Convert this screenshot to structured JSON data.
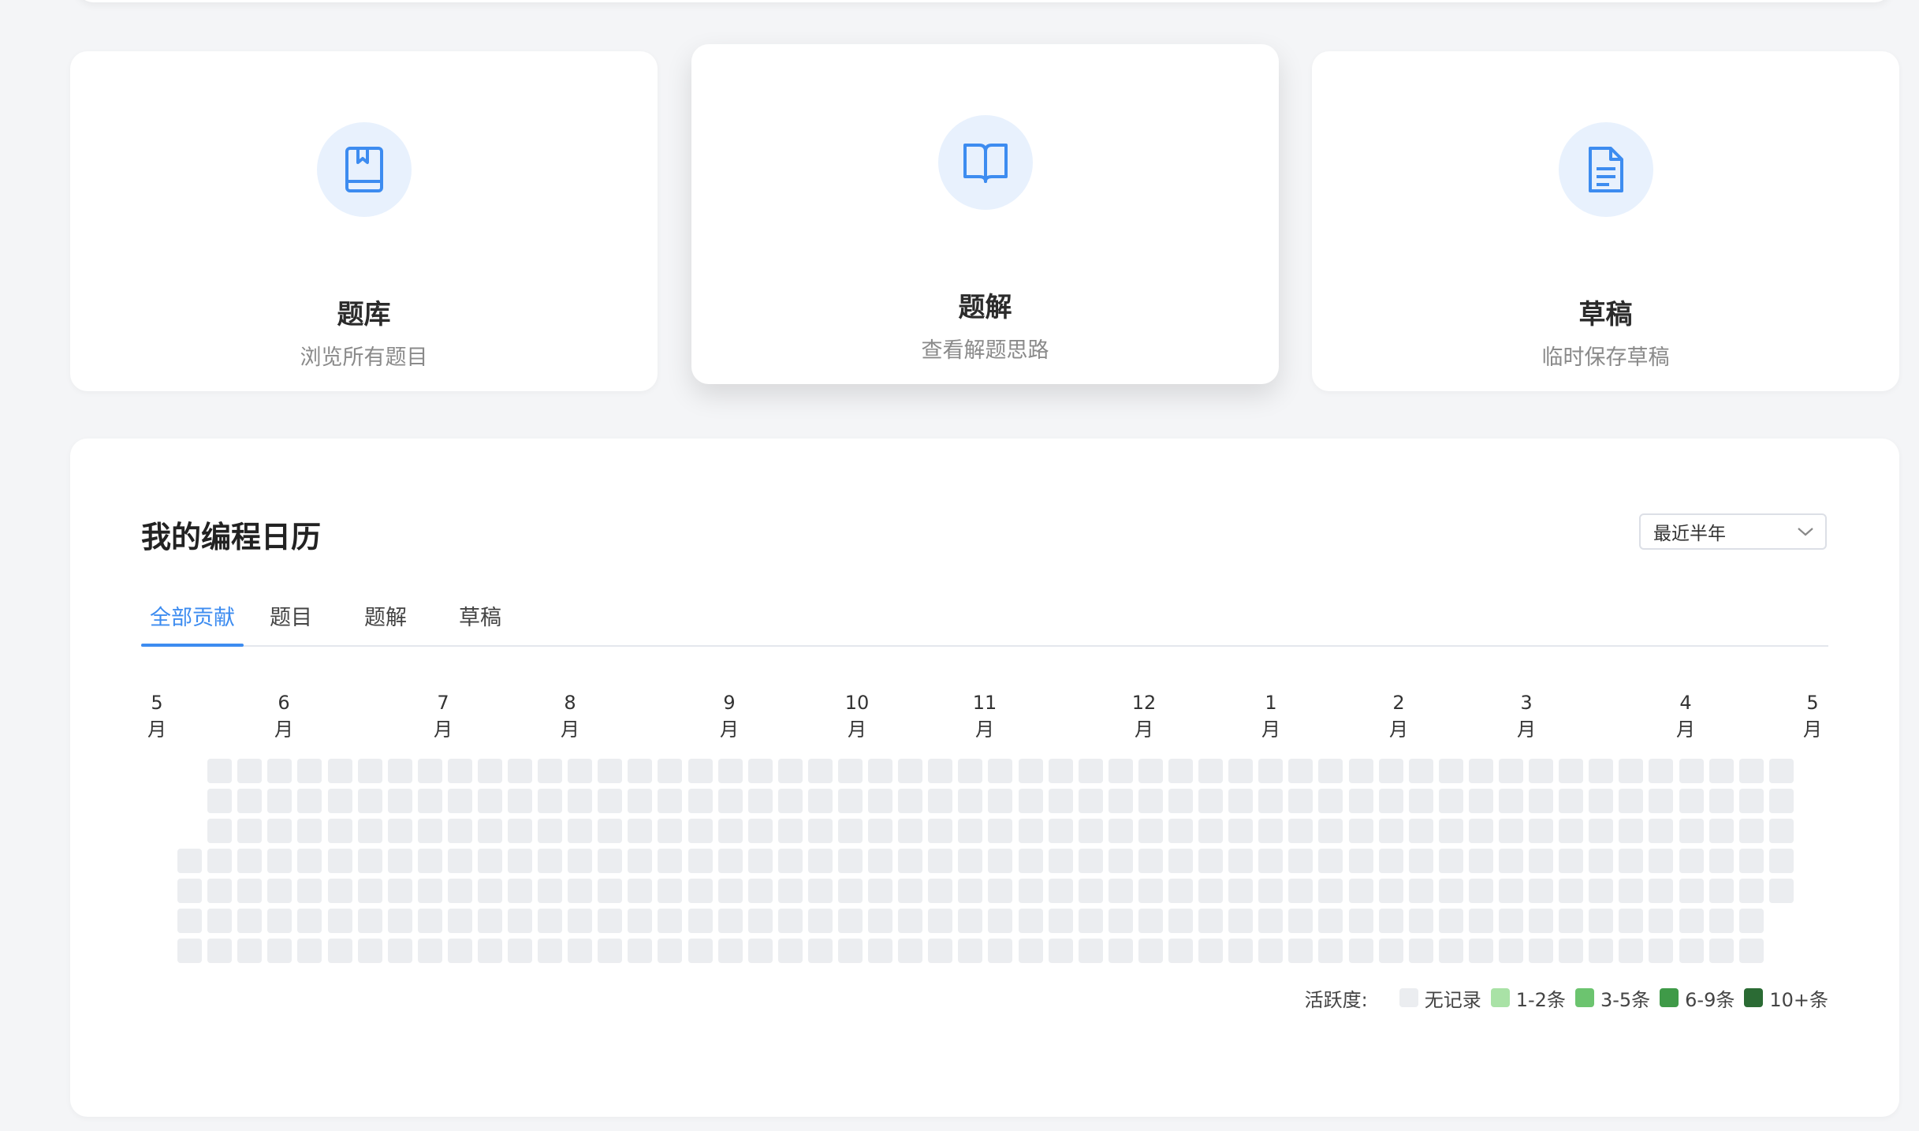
{
  "nav_cards": [
    {
      "title": "题库",
      "subtitle": "浏览所有题目",
      "icon": "bookmark-book-icon"
    },
    {
      "title": "题解",
      "subtitle": "查看解题思路",
      "icon": "open-book-icon"
    },
    {
      "title": "草稿",
      "subtitle": "临时保存草稿",
      "icon": "document-icon"
    }
  ],
  "calendar": {
    "title": "我的编程日历",
    "range_select": {
      "value": "最近半年"
    },
    "tabs": [
      {
        "label": "全部贡献",
        "active": true
      },
      {
        "label": "题目",
        "active": false
      },
      {
        "label": "题解",
        "active": false
      },
      {
        "label": "草稿",
        "active": false
      }
    ],
    "months": [
      {
        "num": "5",
        "unit": "月"
      },
      {
        "num": "6",
        "unit": "月"
      },
      {
        "num": "7",
        "unit": "月"
      },
      {
        "num": "8",
        "unit": "月"
      },
      {
        "num": "9",
        "unit": "月"
      },
      {
        "num": "10",
        "unit": "月"
      },
      {
        "num": "11",
        "unit": "月"
      },
      {
        "num": "12",
        "unit": "月"
      },
      {
        "num": "1",
        "unit": "月"
      },
      {
        "num": "2",
        "unit": "月"
      },
      {
        "num": "3",
        "unit": "月"
      },
      {
        "num": "4",
        "unit": "月"
      },
      {
        "num": "5",
        "unit": "月"
      }
    ],
    "activity": "all cells show no records",
    "legend": {
      "label": "活跃度:",
      "items": [
        {
          "label": "无记录",
          "color": "#ebedf0"
        },
        {
          "label": "1-2条",
          "color": "#a9e2a6"
        },
        {
          "label": "3-5条",
          "color": "#6cc46f"
        },
        {
          "label": "6-9条",
          "color": "#3f9a48"
        },
        {
          "label": "10+条",
          "color": "#2b6b34"
        }
      ]
    },
    "accent_color": "#3d8cf0"
  }
}
